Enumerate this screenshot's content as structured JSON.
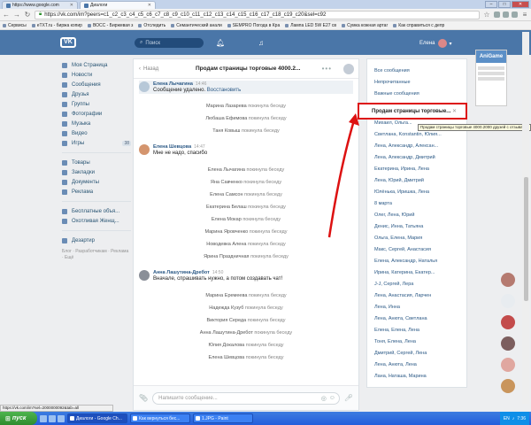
{
  "browser": {
    "tabs": [
      {
        "label": "https://www.google.com"
      },
      {
        "label": "Диалоги"
      }
    ],
    "url": "https://vk.com/im?peers=c1_c2_c3_c4_c5_c6_c7_c8_c9_c10_c11_c12_c13_c14_c15_c16_c17_c18_c19_c20&sel=c92",
    "bookmarks": [
      "Сервисы",
      "eTXT.ru - биржа копир",
      "ВОСС - Биржевая з",
      "Отследить",
      "Семантический анали",
      "SEMPRO Погода в Кра",
      "Лампа LED 5W E27 св",
      "Сумка кожная артаг",
      "Как справиться с депр"
    ],
    "status_url": "https://vk.com/im?sel=2000000092&tab=all"
  },
  "vk_header": {
    "logo": "VK",
    "search_placeholder": "Поиск",
    "user_name": "Елена"
  },
  "left_menu": {
    "items": [
      {
        "label": "Моя Страница"
      },
      {
        "label": "Новости"
      },
      {
        "label": "Сообщения"
      },
      {
        "label": "Друзья"
      },
      {
        "label": "Группы"
      },
      {
        "label": "Фотографии"
      },
      {
        "label": "Музыка"
      },
      {
        "label": "Видео"
      },
      {
        "label": "Игры",
        "count": "38"
      }
    ],
    "items2": [
      {
        "label": "Товары"
      },
      {
        "label": "Закладки"
      },
      {
        "label": "Документы"
      },
      {
        "label": "Реклама"
      }
    ],
    "items3": [
      {
        "label": "Бесплатные объя..."
      },
      {
        "label": "Охотливая Женщ..."
      }
    ],
    "items4": [
      {
        "label": "Дезартир"
      }
    ],
    "footer": "Блог · Разработчикам · Реклама · Ещё"
  },
  "chat": {
    "back_label": "Назад",
    "title": "Продам страницы торговые 4000.2...",
    "messages": [
      {
        "author": "Елена Лычагина",
        "time": "14:46",
        "text": "Сообщение удалено.",
        "action": "Восстановить"
      },
      {
        "author": "Елена Шевцова",
        "time": "14:47",
        "text": "Мне не надо, спасибо"
      },
      {
        "author": "Анна Лашутина-Дребот",
        "time": "14:50",
        "text": "Вначале, спрашивать нужно, а потом создавать чат!"
      }
    ],
    "left_suffix": "покинула беседу",
    "leave_group1": [
      "Марина Лазарева",
      "Любаша Ефимова",
      "Таня Ковыш"
    ],
    "leave_group2": [
      "Елена Лычагина",
      "Яна Савченко",
      "Елена Самсон",
      "Екатерина Белаш",
      "Елена Мокар",
      "Марина Яровченко",
      "Новодевка Алена",
      "Ярина Праздничная"
    ],
    "leave_group3": [
      "Марина Еремеева",
      "Надежда Кузуб",
      "Виктория Середа",
      "Анна Лашутина-Дребот",
      "Юлия Докалова",
      "Елена Шевцова"
    ],
    "composer_placeholder": "Напишите сообщение..."
  },
  "conversations": {
    "top": [
      "Все сообщения",
      "Непрочитанные",
      "Важные сообщения"
    ],
    "selected": "Продам страницы торговые...",
    "tooltip": "Продам страницы торговые 4000.2000 друзей с отзывами",
    "items": [
      "Михаил, Ольга...",
      "Светлана, Konstantin, Юлия...",
      "Лена, Александр, Алексан...",
      "Лена, Александр, Дмитрий",
      "Екатерина, Ирина, Лена",
      "Лена, Юрий, Дмитрий",
      "Юлёнька, Иришка, Лена",
      "8 марта",
      "Олег, Лена, Юрий",
      "Денис, Инна, Татьяна",
      "Ольга, Елена, Мария",
      "Макс, Сергей, Анастасия",
      "Елена, Александр, Наталья",
      "Ирина, Катерина, Екатер...",
      "J-J, Сергей, Лера",
      "Лена, Анастасия, Ларчен",
      "Лена, Инна",
      "Лена, Анюта, Светлана",
      "Елена, Елена, Лена",
      "Тоня, Елена, Лена",
      "Дмитрий, Сергей, Лена",
      "Лена, Анюта, Лена",
      "Лана, Наташа, Марина"
    ]
  },
  "widget": {
    "title": "AniGame"
  },
  "taskbar": {
    "start": "пуск",
    "tasks": [
      "Диалоги - Google Ch...",
      "Как вернуться бес...",
      "1.JPG - Paint"
    ],
    "lang": "EN",
    "clock": "7:36"
  },
  "colors": {
    "vk_blue": "#4a76a8",
    "link": "#2a5885",
    "highlight_red": "#d11"
  }
}
